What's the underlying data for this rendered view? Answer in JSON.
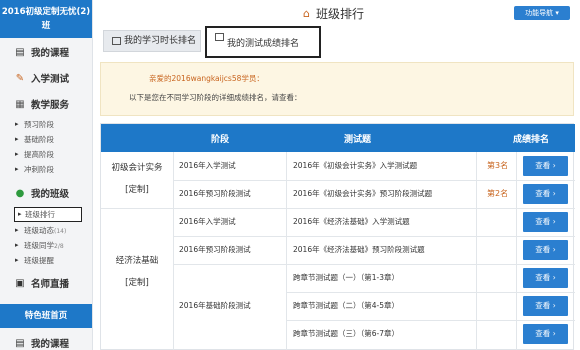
{
  "sidebar": {
    "class_title_line1": "2016初级定制无忧(2)",
    "class_title_line2": "班",
    "my_courses": "我的课程",
    "entrance_test": "入学测试",
    "teaching_service": "教学服务",
    "sub_items": [
      "预习阶段",
      "基础阶段",
      "提高阶段",
      "冲刺阶段"
    ],
    "my_class": "我的班级",
    "class_items": [
      "班级排行",
      "班级动态",
      "班级同学",
      "班级提醒"
    ],
    "class_news_count": "(14)",
    "classmates_count": "2/8",
    "live_teacher": "名师直播",
    "featured_home": "特色班首页"
  },
  "header": {
    "title": "班级排行",
    "function_nav": "功能导航"
  },
  "tabs": [
    "我的学习时长排名",
    "我的测试成绩排名"
  ],
  "notice": {
    "greet_prefix": "亲爱的",
    "user": "2016wangkaijcs58",
    "greet_suffix": "学员：",
    "text": "以下是您在不同学习阶段的详细成绩排名，请查看："
  },
  "table": {
    "headers": [
      "",
      "阶段",
      "测试题",
      "成绩排名"
    ],
    "view_label": "查看",
    "rows": [
      {
        "course": "初级会计实务",
        "tag": "[定制]",
        "stage": "2016年入学测试",
        "test": "2016年《初级会计实务》入学测试题",
        "rank": "第3名"
      },
      {
        "stage": "2016年预习阶段测试",
        "test": "2016年《初级会计实务》预习阶段测试题",
        "rank": "第2名"
      },
      {
        "course": "经济法基础",
        "tag": "[定制]",
        "stage": "2016年入学测试",
        "test": "2016年《经济法基础》入学测试题"
      },
      {
        "stage": "2016年预习阶段测试",
        "test": "2016年《经济法基础》预习阶段测试题"
      },
      {
        "stage": "2016年基础阶段测试",
        "test": "跨章节测试题（一）（第1-3章）"
      },
      {
        "test": "跨章节测试题（二）（第4-5章）"
      },
      {
        "test": "跨章节测试题（三）（第6-7章）"
      }
    ]
  }
}
